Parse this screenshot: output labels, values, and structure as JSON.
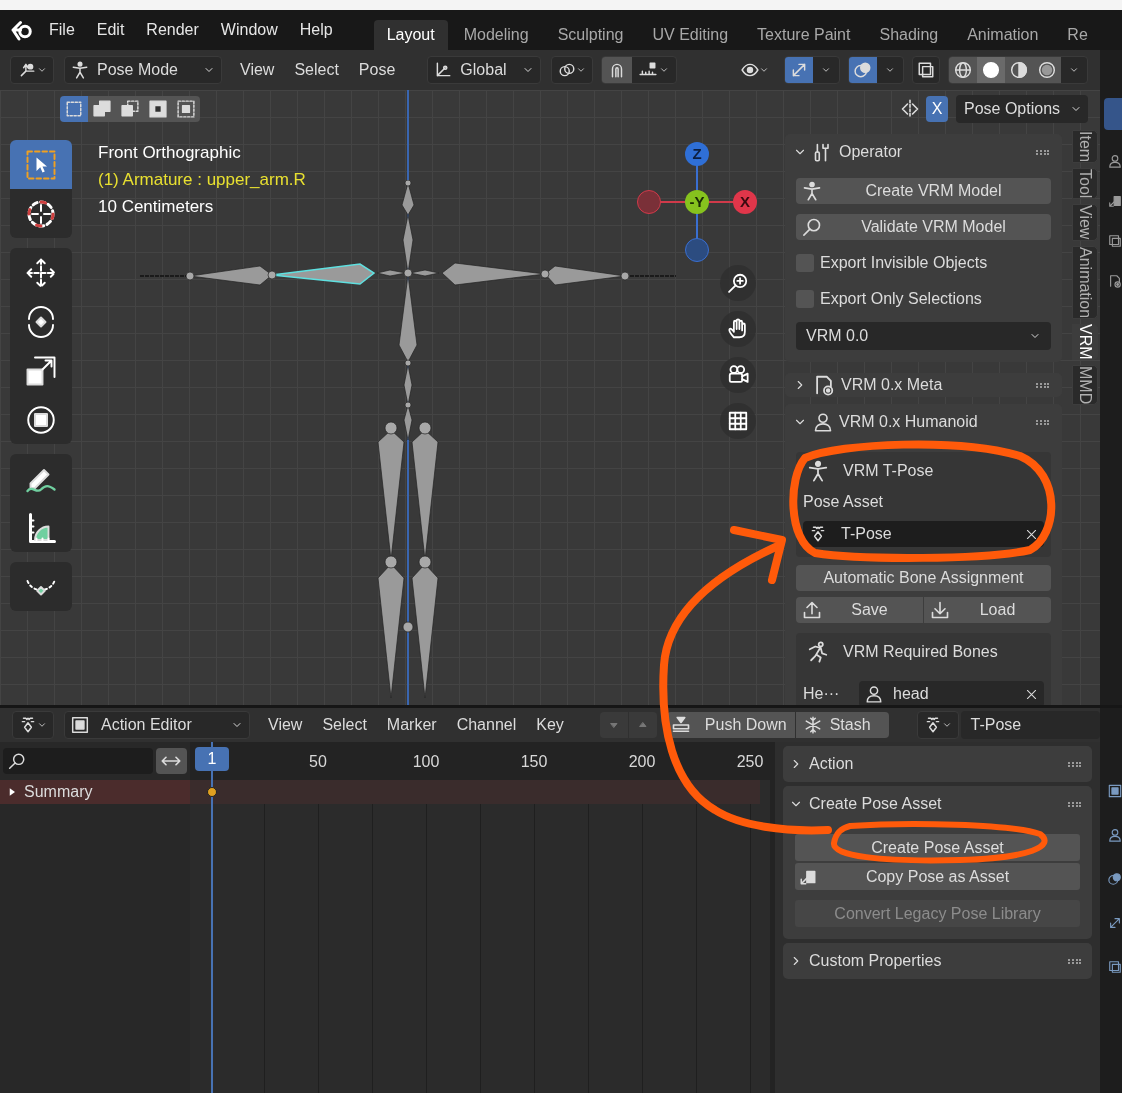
{
  "top_menu": [
    "File",
    "Edit",
    "Render",
    "Window",
    "Help"
  ],
  "workspace_tabs": [
    {
      "label": "Layout",
      "selected": true
    },
    {
      "label": "Modeling",
      "selected": false
    },
    {
      "label": "Sculpting",
      "selected": false
    },
    {
      "label": "UV Editing",
      "selected": false
    },
    {
      "label": "Texture Paint",
      "selected": false
    },
    {
      "label": "Shading",
      "selected": false
    },
    {
      "label": "Animation",
      "selected": false
    },
    {
      "label": "Re",
      "selected": false
    }
  ],
  "viewport_header": {
    "mode": "Pose Mode",
    "menus": [
      "View",
      "Select",
      "Pose"
    ],
    "transform_orientation": "Global",
    "shading_modes": [
      {
        "kind": "wireframe",
        "selected": false
      },
      {
        "kind": "solid",
        "selected": true
      },
      {
        "kind": "material",
        "selected": false
      },
      {
        "kind": "rendered",
        "selected": false
      }
    ],
    "selection_modes": [
      {
        "selected": true
      },
      {
        "selected": false
      },
      {
        "selected": false
      },
      {
        "selected": false
      },
      {
        "selected": false
      }
    ],
    "x_mirror": {
      "label": "X",
      "on": true
    },
    "options": "Pose Options"
  },
  "viewport": {
    "view_name": "Front Orthographic",
    "active_object": "(1) Armature : upper_arm.R",
    "grid_scale": "10 Centimeters",
    "axes": [
      {
        "label": "Z"
      },
      {
        "label": "-Y"
      },
      {
        "label": "X"
      }
    ]
  },
  "toolbar_groups": [
    {
      "tools": [
        {
          "kind": "select-box",
          "selected": true
        },
        {
          "kind": "cursor",
          "selected": false
        }
      ]
    },
    {
      "tools": [
        {
          "kind": "move",
          "selected": false
        },
        {
          "kind": "rotate",
          "selected": false
        },
        {
          "kind": "scale",
          "selected": false
        },
        {
          "kind": "transform",
          "selected": false
        }
      ]
    },
    {
      "tools": [
        {
          "kind": "annotate",
          "selected": false
        },
        {
          "kind": "measure",
          "selected": false
        }
      ]
    },
    {
      "tools": [
        {
          "kind": "curve",
          "selected": false
        }
      ]
    }
  ],
  "sidebar_tabs": [
    {
      "label": "Item",
      "selected": false
    },
    {
      "label": "Tool",
      "selected": false
    },
    {
      "label": "View",
      "selected": false
    },
    {
      "label": "Animation",
      "selected": false
    },
    {
      "label": "VRM",
      "selected": true
    },
    {
      "label": "MMD",
      "selected": false
    }
  ],
  "operator_panel": {
    "title": "Operator",
    "expanded": true,
    "buttons": [
      "Create VRM Model",
      "Validate VRM Model"
    ],
    "checkboxes": [
      {
        "label": "Export Invisible Objects",
        "checked": false
      },
      {
        "label": "Export Only Selections",
        "checked": false
      }
    ],
    "version": "VRM 0.0"
  },
  "meta_panel": {
    "title": "VRM 0.x Meta",
    "expanded": false
  },
  "humanoid_panel": {
    "title": "VRM 0.x Humanoid",
    "expanded": true,
    "tpose_title": "VRM T-Pose",
    "pose_asset_label": "Pose Asset",
    "pose_asset": "T-Pose",
    "auto_assign": "Automatic Bone Assignment",
    "save": "Save",
    "load": "Load",
    "required_title": "VRM Required Bones",
    "bone_label": "He···",
    "bone_value": "head"
  },
  "dopesheet_header": {
    "mode": "Action Editor",
    "menus": [
      "View",
      "Select",
      "Marker",
      "Channel",
      "Key"
    ],
    "push_down": "Push Down",
    "stash": "Stash",
    "action": "T-Pose"
  },
  "timeline": {
    "current_frame": "1",
    "frame_ticks": [
      "50",
      "100",
      "150",
      "200",
      "250"
    ],
    "channels": [
      {
        "label": "Summary",
        "expanded": false
      }
    ]
  },
  "dopesheet_sidebar": [
    {
      "title": "Action",
      "expanded": false
    },
    {
      "title": "Create Pose Asset",
      "expanded": true,
      "buttons": [
        {
          "label": "Create Pose Asset",
          "kind": "plain",
          "disabled": false
        },
        {
          "label": "Copy Pose as Asset",
          "kind": "copy",
          "disabled": false
        },
        {
          "label": "Convert Legacy Pose Library",
          "kind": "plain",
          "disabled": true
        }
      ]
    },
    {
      "title": "Custom Properties",
      "expanded": false
    }
  ]
}
